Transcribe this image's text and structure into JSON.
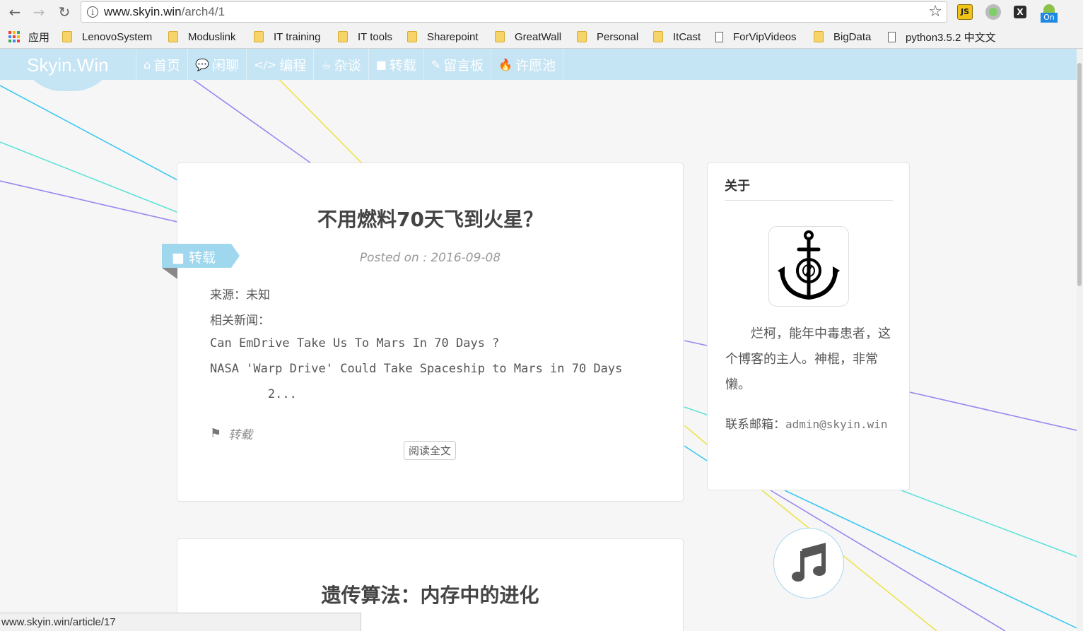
{
  "browser": {
    "url_host": "www.skyin.win",
    "url_path": "/arch4/1",
    "bookmarks": [
      {
        "label": "应用",
        "type": "apps"
      },
      {
        "label": "LenovoSystem",
        "type": "folder"
      },
      {
        "label": "Moduslink",
        "type": "folder"
      },
      {
        "label": "IT training",
        "type": "folder"
      },
      {
        "label": "IT tools",
        "type": "folder"
      },
      {
        "label": "Sharepoint",
        "type": "folder"
      },
      {
        "label": "GreatWall",
        "type": "folder"
      },
      {
        "label": "Personal",
        "type": "folder"
      },
      {
        "label": "ItCast",
        "type": "folder"
      },
      {
        "label": "ForVipVideos",
        "type": "page"
      },
      {
        "label": "BigData",
        "type": "folder"
      },
      {
        "label": "python3.5.2 中文文",
        "type": "page"
      }
    ],
    "extensions": [
      "js-extension-icon",
      "green-dot-extension-icon",
      "x-extension-icon",
      "on-toggle-extension-icon"
    ],
    "ext_on_label": "On",
    "ext_js_label": "JS",
    "ext_x_label": "X",
    "status_url": "www.skyin.win/article/17"
  },
  "site": {
    "logo": "Skyin.Win",
    "nav": [
      {
        "icon": "home-icon",
        "glyph": "⌂",
        "label": "首页"
      },
      {
        "icon": "chat-icon",
        "glyph": "💬",
        "label": "闲聊"
      },
      {
        "icon": "code-icon",
        "glyph": "</>",
        "label": "编程"
      },
      {
        "icon": "coffee-icon",
        "glyph": "☕",
        "label": "杂谈"
      },
      {
        "icon": "video-icon",
        "glyph": "■",
        "label": "转载"
      },
      {
        "icon": "edit-icon",
        "glyph": "✎",
        "label": "留言板"
      },
      {
        "icon": "flame-icon",
        "glyph": "🔥",
        "label": "许愿池"
      }
    ]
  },
  "posts": [
    {
      "title": "不用燃料70天飞到火星？",
      "posted": "Posted on : 2016-09-08",
      "category": "转载",
      "excerpt": [
        "来源：未知",
        "相关新闻：",
        "Can EmDrive Take Us To Mars In 70 Days ?",
        "NASA 'Warp Drive' Could Take Spaceship to Mars in 70 Days",
        "        2..."
      ],
      "tag": "转载",
      "read_more": "阅读全文"
    },
    {
      "title": "遗传算法：内存中的进化"
    }
  ],
  "sidebar": {
    "title": "关于",
    "bio": "　　烂柯，能年中毒患者，这个博客的主人。神棍，非常懒。",
    "mail_label": "联系邮箱：",
    "mail": "admin@skyin.win"
  },
  "colors": {
    "nav_bg": "#c5e4f4",
    "ribbon": "#9fd7ee",
    "line_blue": "#3cc8f0",
    "line_cyan": "#5fe3d9",
    "line_purple": "#9a86f0",
    "line_yellow": "#ece34a"
  }
}
